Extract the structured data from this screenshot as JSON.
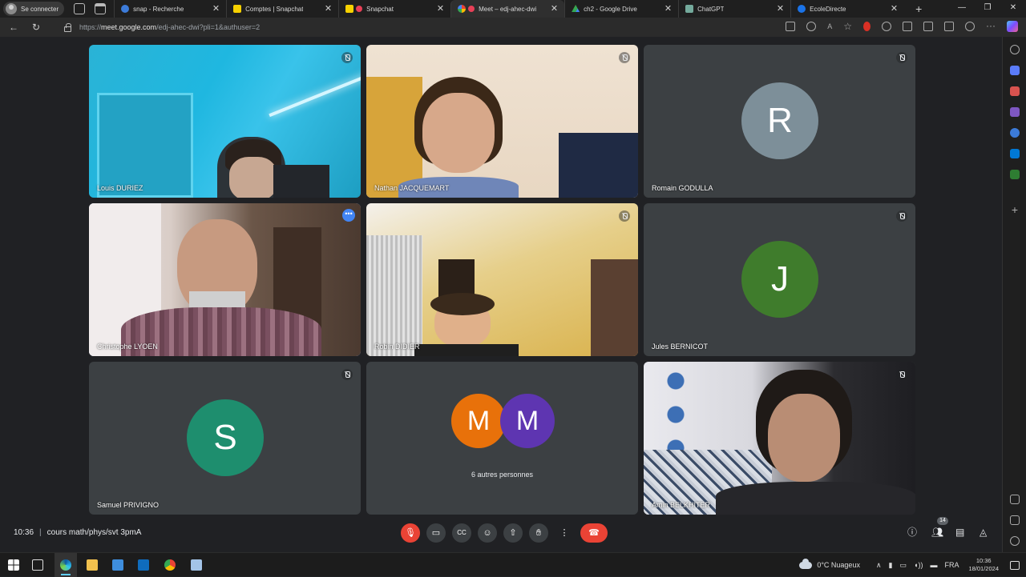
{
  "browser": {
    "profile_label": "Se connecter",
    "tabs": [
      {
        "label": "snap - Recherche",
        "fav_color": "#3c7bd9",
        "active": false
      },
      {
        "label": "Comptes | Snapchat",
        "fav_color": "#f7d100",
        "active": false
      },
      {
        "label": "Snapchat",
        "fav_color": "#f7d100",
        "active": false
      },
      {
        "label": "Meet – edj-ahec-dwi",
        "fav_color": "#34a853",
        "active": true
      },
      {
        "label": "ch2 - Google Drive",
        "fav_color": "#1fa463",
        "active": false
      },
      {
        "label": "ChatGPT",
        "fav_color": "#74aa9c",
        "active": false
      },
      {
        "label": "EcoleDirecte",
        "fav_color": "#1a73e8",
        "active": false
      }
    ],
    "url_prefix": "https://",
    "url_domain": "meet.google.com",
    "url_path": "/edj-ahec-dwi?pli=1&authuser=2"
  },
  "participants": [
    {
      "name": "Louis DURIEZ",
      "type": "video",
      "muted": true
    },
    {
      "name": "Nathan JACQUEMART",
      "type": "video",
      "muted": true
    },
    {
      "name": "Romain GODULLA",
      "type": "avatar",
      "initial": "R",
      "color": "#7d8f99",
      "muted": true
    },
    {
      "name": "Christophe LYOEN",
      "type": "video",
      "muted": false,
      "speaking": true
    },
    {
      "name": "Robin DIDIER",
      "type": "video",
      "muted": true
    },
    {
      "name": "Jules BERNICOT",
      "type": "avatar",
      "initial": "J",
      "color": "#3f7c2c",
      "muted": true
    },
    {
      "name": "Samuel PRIVIGNO",
      "type": "avatar",
      "initial": "S",
      "color": "#1e8e6e",
      "muted": true
    },
    {
      "name": "Amin BELKHITER",
      "type": "video",
      "muted": true
    }
  ],
  "others": {
    "initials": [
      "M",
      "M"
    ],
    "colors": [
      "#e8710a",
      "#5e35b1"
    ],
    "label": "6 autres personnes"
  },
  "meeting": {
    "time": "10:36",
    "separator": "|",
    "title": "cours math/phys/svt 3pmA",
    "participants_count": "14",
    "controls": [
      "mic-off",
      "camera",
      "captions",
      "emoji",
      "present",
      "raise-hand",
      "more",
      "end-call"
    ]
  },
  "taskbar": {
    "weather": "0°C  Nuageux",
    "lang": "FRA",
    "time": "10:36",
    "date": "18/01/2024"
  }
}
